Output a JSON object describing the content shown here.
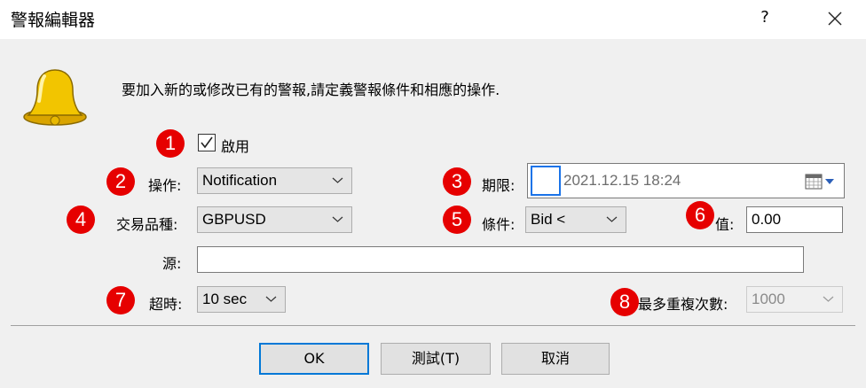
{
  "window": {
    "title": "警報編輯器",
    "help": "?"
  },
  "intro": "要加入新的或修改已有的警報,請定義警報條件和相應的操作.",
  "badges": [
    "1",
    "2",
    "3",
    "4",
    "5",
    "6",
    "7",
    "8"
  ],
  "enable": {
    "label": "啟用",
    "checked": true
  },
  "action": {
    "label": "操作:",
    "value": "Notification"
  },
  "expiry": {
    "label": "期限:",
    "value": "2021.12.15 18:24"
  },
  "symbol": {
    "label": "交易品種:",
    "value": "GBPUSD"
  },
  "condition": {
    "label": "條件:",
    "value": "Bid <"
  },
  "value": {
    "label": "值:",
    "value": "0.00"
  },
  "source": {
    "label": "源:",
    "value": ""
  },
  "timeout": {
    "label": "超時:",
    "value": "10 sec"
  },
  "max_iterations": {
    "label": "最多重複次數:",
    "value": "1000"
  },
  "buttons": {
    "ok": "OK",
    "test": "測試(T)",
    "cancel": "取消"
  },
  "colors": {
    "badge": "#e60000",
    "accent": "#0078d7",
    "bell": "#f2c500"
  }
}
